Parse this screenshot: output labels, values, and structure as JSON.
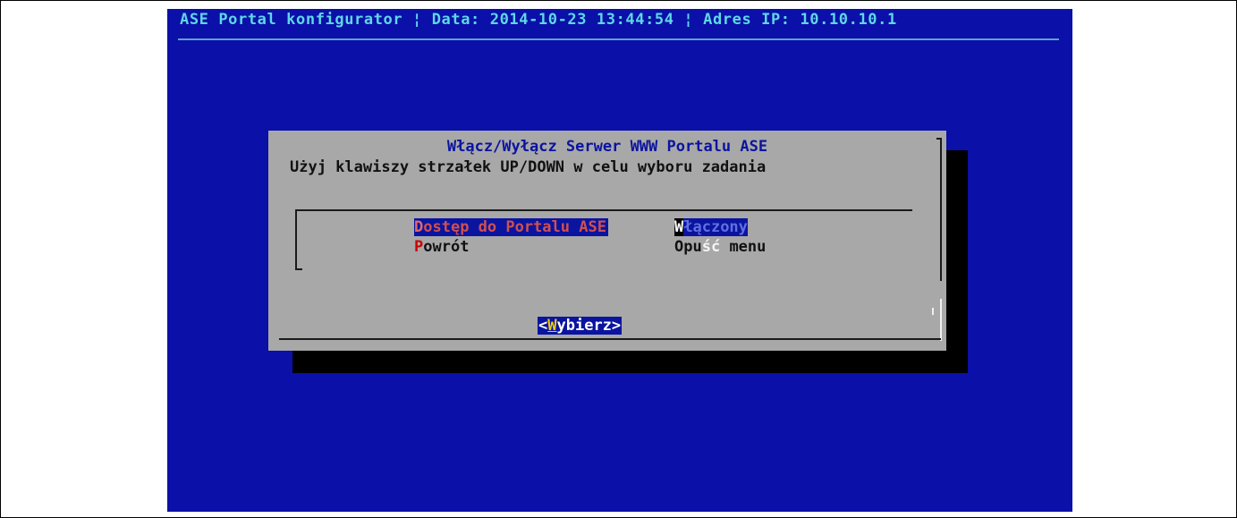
{
  "header": {
    "app_name": "ASE Portal konfigurator",
    "sep1": " ¦ ",
    "date_label": "Data: 2014-10-23 13:44:54",
    "sep2": " ¦ ",
    "ip_label": "Adres IP: 10.10.10.1"
  },
  "dialog": {
    "title": "Włącz/Wyłącz Serwer WWW Portalu ASE",
    "subtitle": "Użyj klawiszy strzałek UP/DOWN w celu wyboru zadania",
    "items": [
      {
        "hotkey": "D",
        "label_rest": "ostęp do Portalu ASE",
        "value_first": "W",
        "value_rest": "łączony"
      },
      {
        "hotkey": "P",
        "label_rest": "owrót",
        "value_a": "Opu",
        "value_b": "ść",
        "value_c": " menu"
      }
    ],
    "button": {
      "open": "<",
      "hotkey": "W",
      "rest": "ybierz",
      "close": ">"
    }
  },
  "colors": {
    "screen_bg": "#0a10a8",
    "dialog_bg": "#a8a8a8",
    "title_text": "#5fd7e8",
    "highlight_bg": "#0a14a0",
    "hotkey_red": "#cc0000"
  }
}
